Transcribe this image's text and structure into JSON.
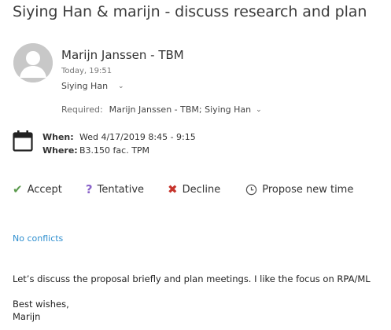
{
  "subject": "Siying Han & marijn - discuss research and plan",
  "sender": {
    "name": "Marijn Janssen - TBM",
    "time": "Today, 19:51",
    "to": "Siying Han"
  },
  "recipients": {
    "required_label": "Required:",
    "required_value": "Marijn Janssen - TBM; Siying Han"
  },
  "meeting": {
    "when_label": "When:",
    "when_value": "Wed 4/17/2019 8:45 - 9:15",
    "where_label": "Where:",
    "where_value": "B3.150 fac. TPM"
  },
  "actions": {
    "accept": "Accept",
    "tentative": "Tentative",
    "decline": "Decline",
    "propose": "Propose new time"
  },
  "conflicts": "No conflicts",
  "body": {
    "line1": "Let’s discuss the proposal briefly and plan meetings. I like the focus on RPA/ML",
    "closing": "Best wishes,",
    "signature": "Marijn"
  },
  "colors": {
    "accept": "#5b9a4d",
    "tentative": "#8a63c9",
    "decline": "#c6342c",
    "link": "#2f8fcf"
  },
  "icons": {
    "avatar": "person-avatar-icon",
    "calendar": "calendar-icon",
    "accept": "checkmark-icon",
    "tentative": "question-mark-icon",
    "decline": "x-icon",
    "propose": "clock-icon",
    "expand": "chevron-down-icon"
  }
}
